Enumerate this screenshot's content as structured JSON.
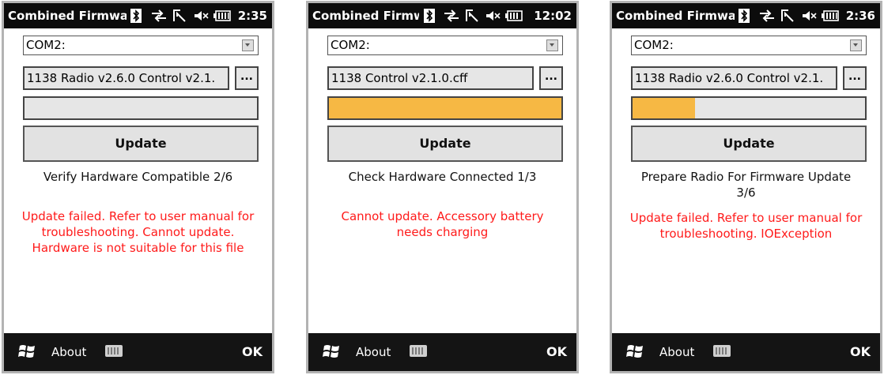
{
  "screens": [
    {
      "title": "Combined Firmwar",
      "clock": "2:35",
      "port": "COM2:",
      "file": "1138 Radio v2.6.0 Control v2.1.",
      "browse_label": "...",
      "progress": 0,
      "update_label": "Update",
      "status": "Verify Hardware Compatible 2/6",
      "error": "Update failed. Refer to user manual for troubleshooting. Cannot update. Hardware is not suitable for this file",
      "about_label": "About",
      "ok_label": "OK"
    },
    {
      "title": "Combined Firmw:",
      "clock": "12:02",
      "port": "COM2:",
      "file": "1138 Control v2.1.0.cff",
      "browse_label": "...",
      "progress": 1.0,
      "update_label": "Update",
      "status": "Check Hardware Connected 1/3",
      "error": "Cannot update. Accessory battery needs charging",
      "about_label": "About",
      "ok_label": "OK"
    },
    {
      "title": "Combined Firmwar",
      "clock": "2:36",
      "port": "COM2:",
      "file": "1138 Radio v2.6.0 Control v2.1.",
      "browse_label": "...",
      "progress": 0.27,
      "update_label": "Update",
      "status": "Prepare Radio For Firmware Update 3/6",
      "error": "Update failed. Refer to user manual for troubleshooting. IOException",
      "about_label": "About",
      "ok_label": "OK"
    }
  ],
  "colors": {
    "progress_fill": "#f6b844",
    "error_text": "#ff1a1a",
    "bar_background": "#0c0c0c"
  },
  "icons": [
    "bluetooth-icon",
    "connectivity-icon",
    "signal-icon",
    "volume-mute-icon",
    "battery-icon",
    "windows-start-icon",
    "keyboard-icon"
  ]
}
